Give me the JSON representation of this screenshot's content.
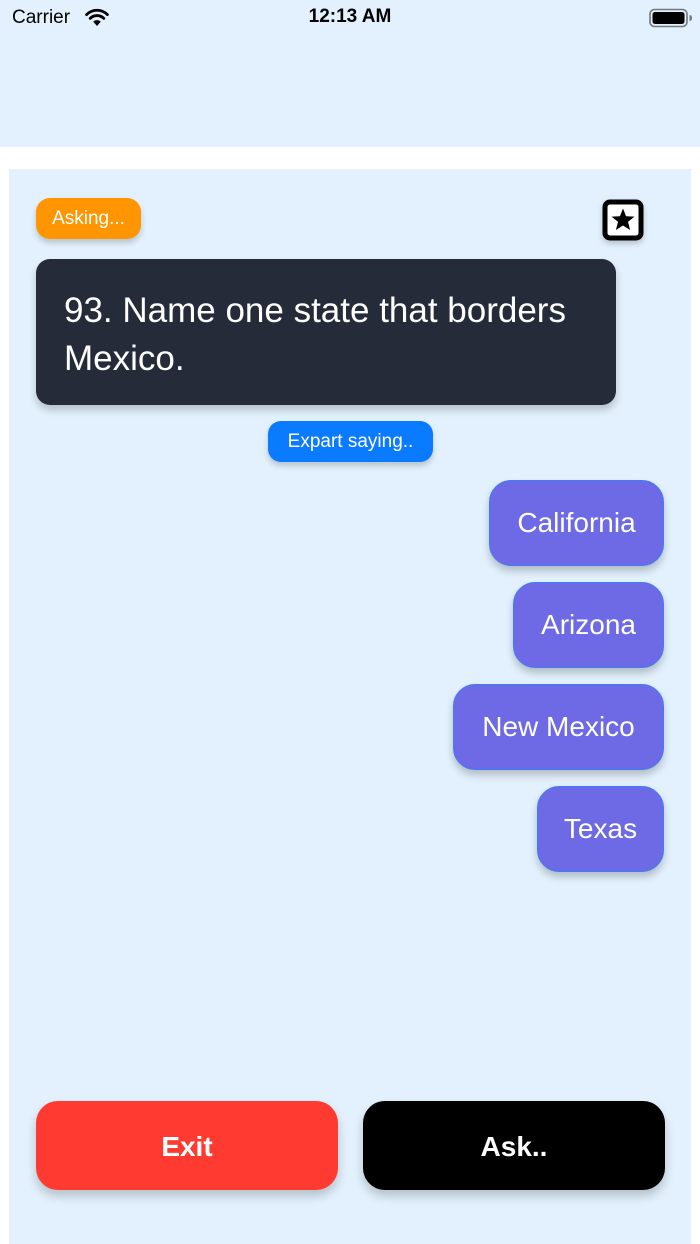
{
  "status_bar": {
    "carrier": "Carrier",
    "time": "12:13 AM"
  },
  "quiz": {
    "status_label": "Asking...",
    "question": "93. Name one state that borders Mexico.",
    "expert_label": "Expart saying..",
    "answers": [
      {
        "label": "California"
      },
      {
        "label": "Arizona"
      },
      {
        "label": "New Mexico"
      },
      {
        "label": "Texas"
      }
    ]
  },
  "actions": {
    "exit_label": "Exit",
    "ask_label": "Ask.."
  },
  "colors": {
    "background": "#e2f1fd",
    "asking_badge": "#ff9500",
    "question_card": "#262b39",
    "expert_badge": "#0a7aff",
    "answer_bubble": "#6e69e4",
    "exit_button": "#ff3a30",
    "ask_button": "#000000"
  },
  "icons": {
    "wifi": "wifi-icon",
    "battery": "battery-icon",
    "favorite": "star-icon"
  }
}
